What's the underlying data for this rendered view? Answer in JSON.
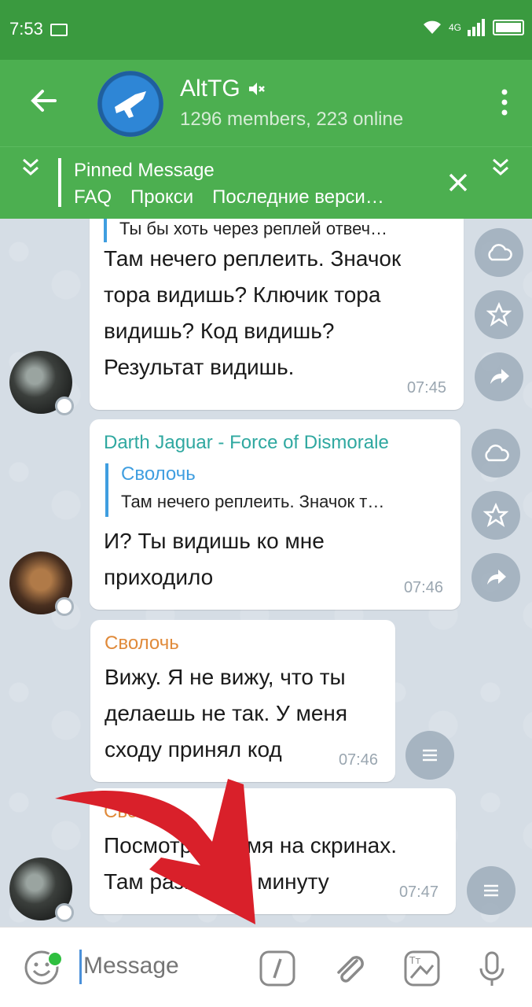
{
  "status_bar": {
    "time": "7:53",
    "network": "4G"
  },
  "header": {
    "title": "AltTG",
    "subtitle": "1296 members, 223 online"
  },
  "pinned": {
    "title": "Pinned Message",
    "links": [
      "FAQ",
      "Прокси",
      "Последние верси…"
    ]
  },
  "messages": [
    {
      "reply_text": "Ты бы хоть через реплей отвеч…",
      "lines": [
        "Там нечего реплеить. Значок",
        "тора видишь? Ключик тора",
        "видишь? Код видишь?",
        "Результат видишь."
      ],
      "time": "07:45"
    },
    {
      "sender": "Darth Jaguar - Force of Dismorale",
      "reply_name": "Сволочь",
      "reply_text": "Там нечего реплеить. Значок т…",
      "lines": [
        "И? Ты видишь ко мне",
        "приходило"
      ],
      "time": "07:46"
    },
    {
      "sender": "Сволочь",
      "lines": [
        "Вижу. Я не вижу, что ты",
        "делаешь не так. У меня",
        "сходу принял код"
      ],
      "time": "07:46"
    },
    {
      "sender": "Сволочь",
      "lines": [
        "Посмотри время на скринах.",
        "Там разница в минуту"
      ],
      "time": "07:47"
    }
  ],
  "input": {
    "placeholder": "Message"
  },
  "colors": {
    "header": "#4caf50",
    "status_bar": "#3a9a3f",
    "sender_blue": "#2fa8a0",
    "sender_orange": "#e08a3a",
    "reply_bar": "#3f9ee0"
  }
}
